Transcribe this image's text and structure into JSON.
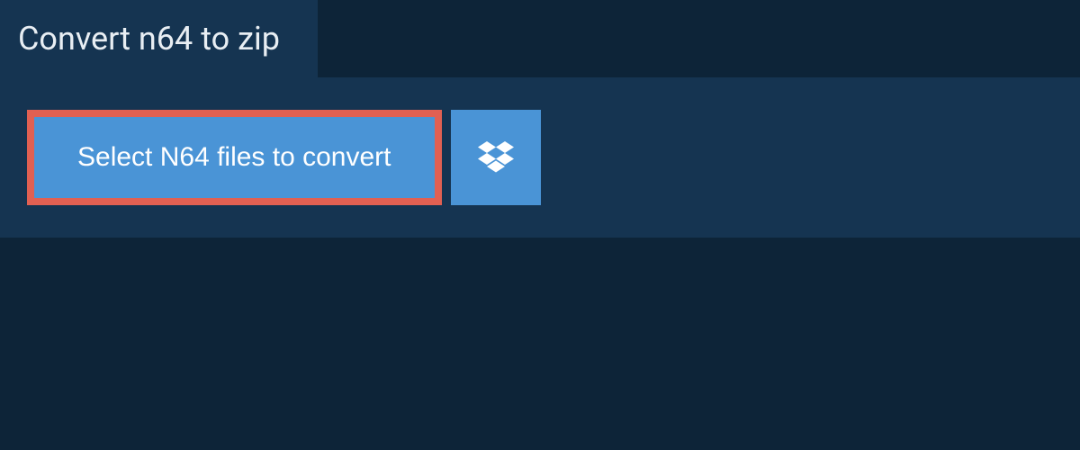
{
  "header": {
    "title": "Convert n64 to zip"
  },
  "main": {
    "select_button_label": "Select N64 files to convert"
  },
  "colors": {
    "bg_dark": "#0d2438",
    "bg_panel": "#153451",
    "button_blue": "#4a94d6",
    "highlight_border": "#e16052",
    "text_light": "#e8eef3"
  }
}
